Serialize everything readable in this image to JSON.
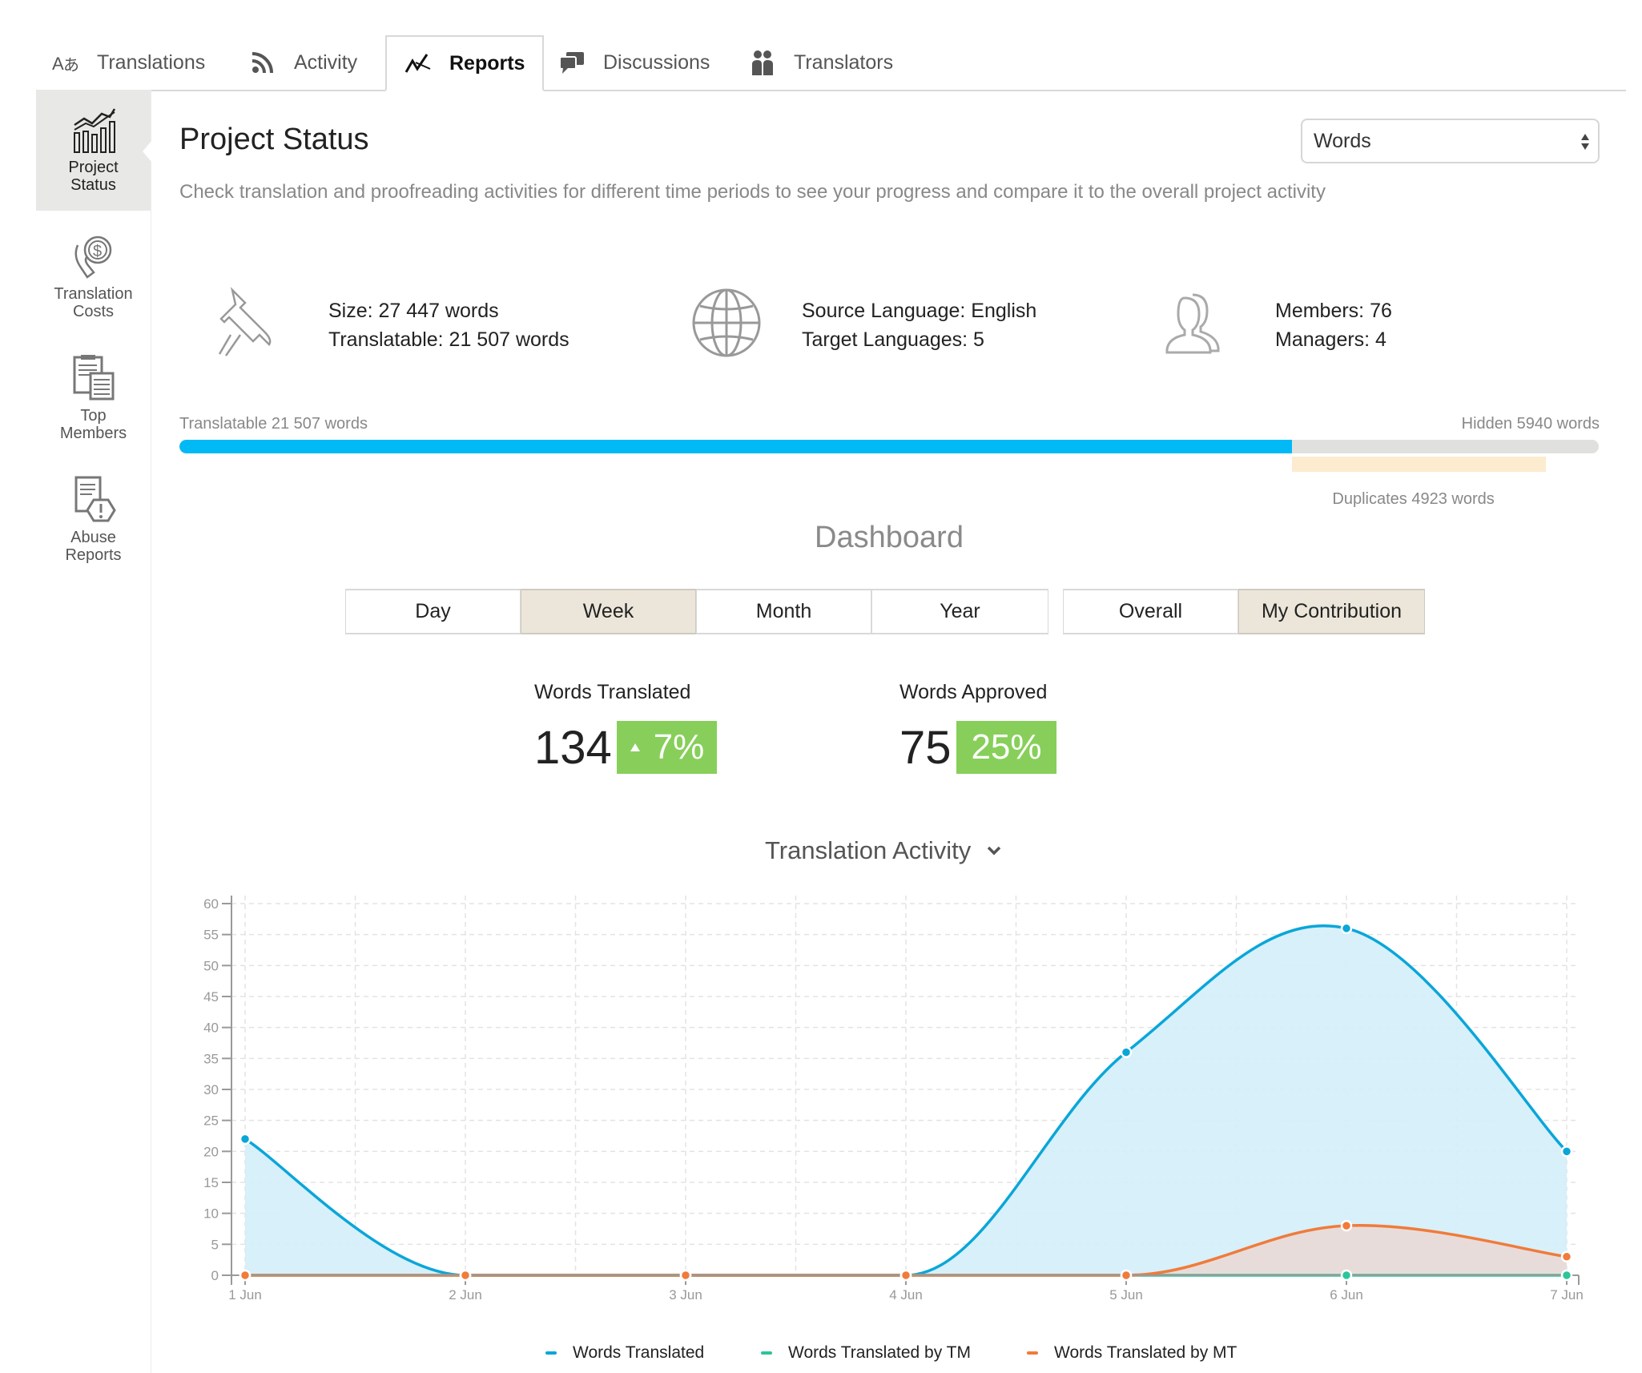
{
  "tabs": [
    {
      "label": "Translations",
      "icon": "translate-icon",
      "active": false
    },
    {
      "label": "Activity",
      "icon": "rss-icon",
      "active": false
    },
    {
      "label": "Reports",
      "icon": "chart-line-icon",
      "active": true
    },
    {
      "label": "Discussions",
      "icon": "chat-bubbles-icon",
      "active": false
    },
    {
      "label": "Translators",
      "icon": "people-icon",
      "active": false
    }
  ],
  "sidebar": {
    "items": [
      {
        "label_line1": "Project",
        "label_line2": "Status",
        "icon": "bar-chart-icon",
        "active": true
      },
      {
        "label_line1": "Translation",
        "label_line2": "Costs",
        "icon": "money-hand-icon",
        "active": false
      },
      {
        "label_line1": "Top",
        "label_line2": "Members",
        "icon": "documents-icon",
        "active": false
      },
      {
        "label_line1": "Abuse",
        "label_line2": "Reports",
        "icon": "report-warning-icon",
        "active": false
      }
    ]
  },
  "header": {
    "title": "Project Status",
    "subtitle": "Check translation and proofreading activities for different time periods to see your progress and compare it to the overall project activity",
    "unit_select": {
      "value": "Words"
    }
  },
  "info": {
    "size": "Size: 27 447 words",
    "translatable": "Translatable: 21 507 words",
    "source_language": "Source Language: English",
    "target_languages": "Target Languages: 5",
    "members": "Members: 76",
    "managers": "Managers: 4"
  },
  "progress": {
    "translatable_label": "Translatable 21 507 words",
    "hidden_label": "Hidden 5940 words",
    "duplicates_label": "Duplicates 4923 words",
    "translatable_words": 21507,
    "hidden_words": 5940,
    "duplicates_words": 4923,
    "total_words": 27447,
    "colors": {
      "translatable": "#00b9f5",
      "hidden": "#e0e1df",
      "duplicates": "#fdebcf"
    }
  },
  "dashboard": {
    "title": "Dashboard",
    "periods": [
      {
        "label": "Day",
        "selected": false
      },
      {
        "label": "Week",
        "selected": true
      },
      {
        "label": "Month",
        "selected": false
      },
      {
        "label": "Year",
        "selected": false
      }
    ],
    "scope": [
      {
        "label": "Overall",
        "selected": false
      },
      {
        "label": "My Contribution",
        "selected": true
      }
    ],
    "stats": {
      "words_translated": {
        "label": "Words Translated",
        "value": "134",
        "change": "7%",
        "trend": "up"
      },
      "words_approved": {
        "label": "Words Approved",
        "value": "75",
        "change": "25%"
      }
    },
    "badge_color": "#87cf5a"
  },
  "chart_data": {
    "type": "area",
    "title": "Translation Activity",
    "xlabel": "",
    "ylabel": "",
    "categories": [
      "1 Jun",
      "2 Jun",
      "3 Jun",
      "4 Jun",
      "5 Jun",
      "6 Jun",
      "7 Jun"
    ],
    "ylim": [
      0,
      60
    ],
    "yticks": [
      0,
      5,
      10,
      15,
      20,
      25,
      30,
      35,
      40,
      45,
      50,
      55,
      60
    ],
    "grid": true,
    "legend_position": "bottom",
    "series": [
      {
        "name": "Words Translated",
        "color": "#0aa6d9",
        "fill": "#d3eefa",
        "values": [
          22,
          0,
          0,
          0,
          36,
          56,
          20
        ]
      },
      {
        "name": "Words Translated by TM",
        "color": "#2dc59a",
        "fill": "none",
        "values": [
          0,
          0,
          0,
          0,
          0,
          0,
          0
        ]
      },
      {
        "name": "Words Translated by MT",
        "color": "#f07b3a",
        "fill": "#ead9d6",
        "values": [
          0,
          0,
          0,
          0,
          0,
          8,
          3
        ]
      }
    ]
  }
}
